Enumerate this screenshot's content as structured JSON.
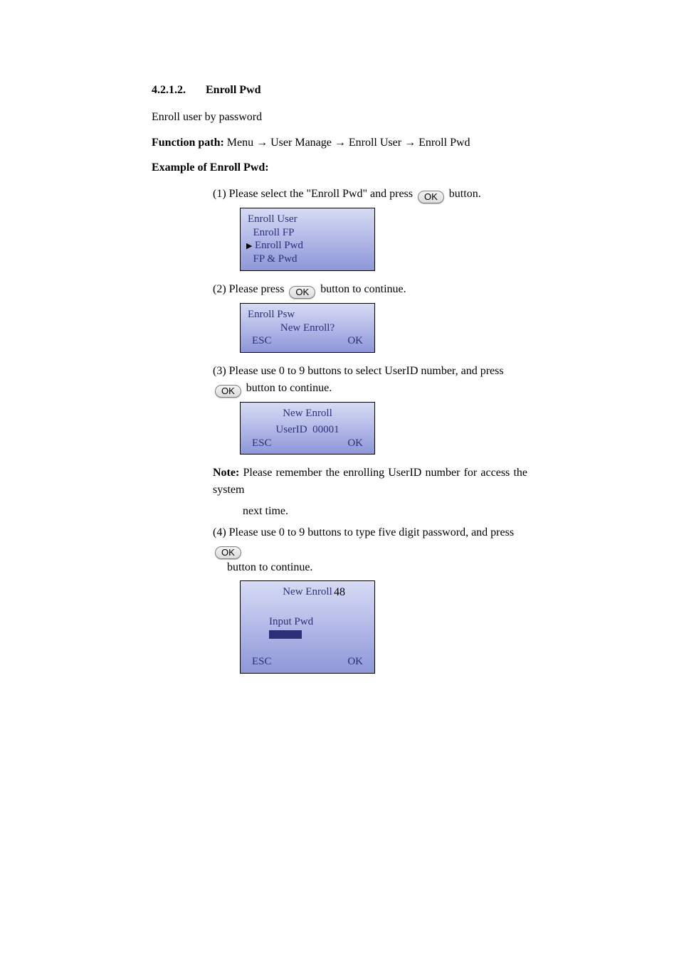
{
  "heading": {
    "number": "4.2.1.2.",
    "title": "Enroll Pwd"
  },
  "intro": "Enroll user by password",
  "function_path": {
    "label": "Function path:",
    "segments": [
      "Menu",
      "User Manage",
      "Enroll User",
      "Enroll Pwd"
    ]
  },
  "example_label": "Example of Enroll Pwd:",
  "ok_label": "OK",
  "steps": {
    "s1": {
      "pre": "(1) Please select the \"Enroll Pwd\" and press ",
      "post": " button."
    },
    "s2": {
      "pre": "(2) Please press ",
      "post": " button to continue."
    },
    "s3": {
      "line1": "(3) Please use 0 to 9 buttons to select UserID number, and press",
      "line2": " button to continue."
    },
    "s4": {
      "pre": "(4) Please use 0 to 9 buttons to type five digit password, and press ",
      "post": "button to continue."
    }
  },
  "lcd1": {
    "title": "Enroll User",
    "item1": "Enroll FP",
    "item2": "Enroll Pwd",
    "item3": "FP & Pwd"
  },
  "lcd2": {
    "title": "Enroll Psw",
    "line": "New Enroll?",
    "esc": "ESC",
    "ok": "OK"
  },
  "lcd3": {
    "title": "New Enroll",
    "line": "UserID  00001",
    "esc": "ESC",
    "ok": "OK"
  },
  "lcd4": {
    "title": "New Enroll",
    "label": "Input Pwd",
    "esc": "ESC",
    "ok": "OK"
  },
  "note": {
    "label": "Note:",
    "text1": " Please remember the enrolling UserID number for access the system",
    "text2": "next time."
  },
  "page_number": "48"
}
